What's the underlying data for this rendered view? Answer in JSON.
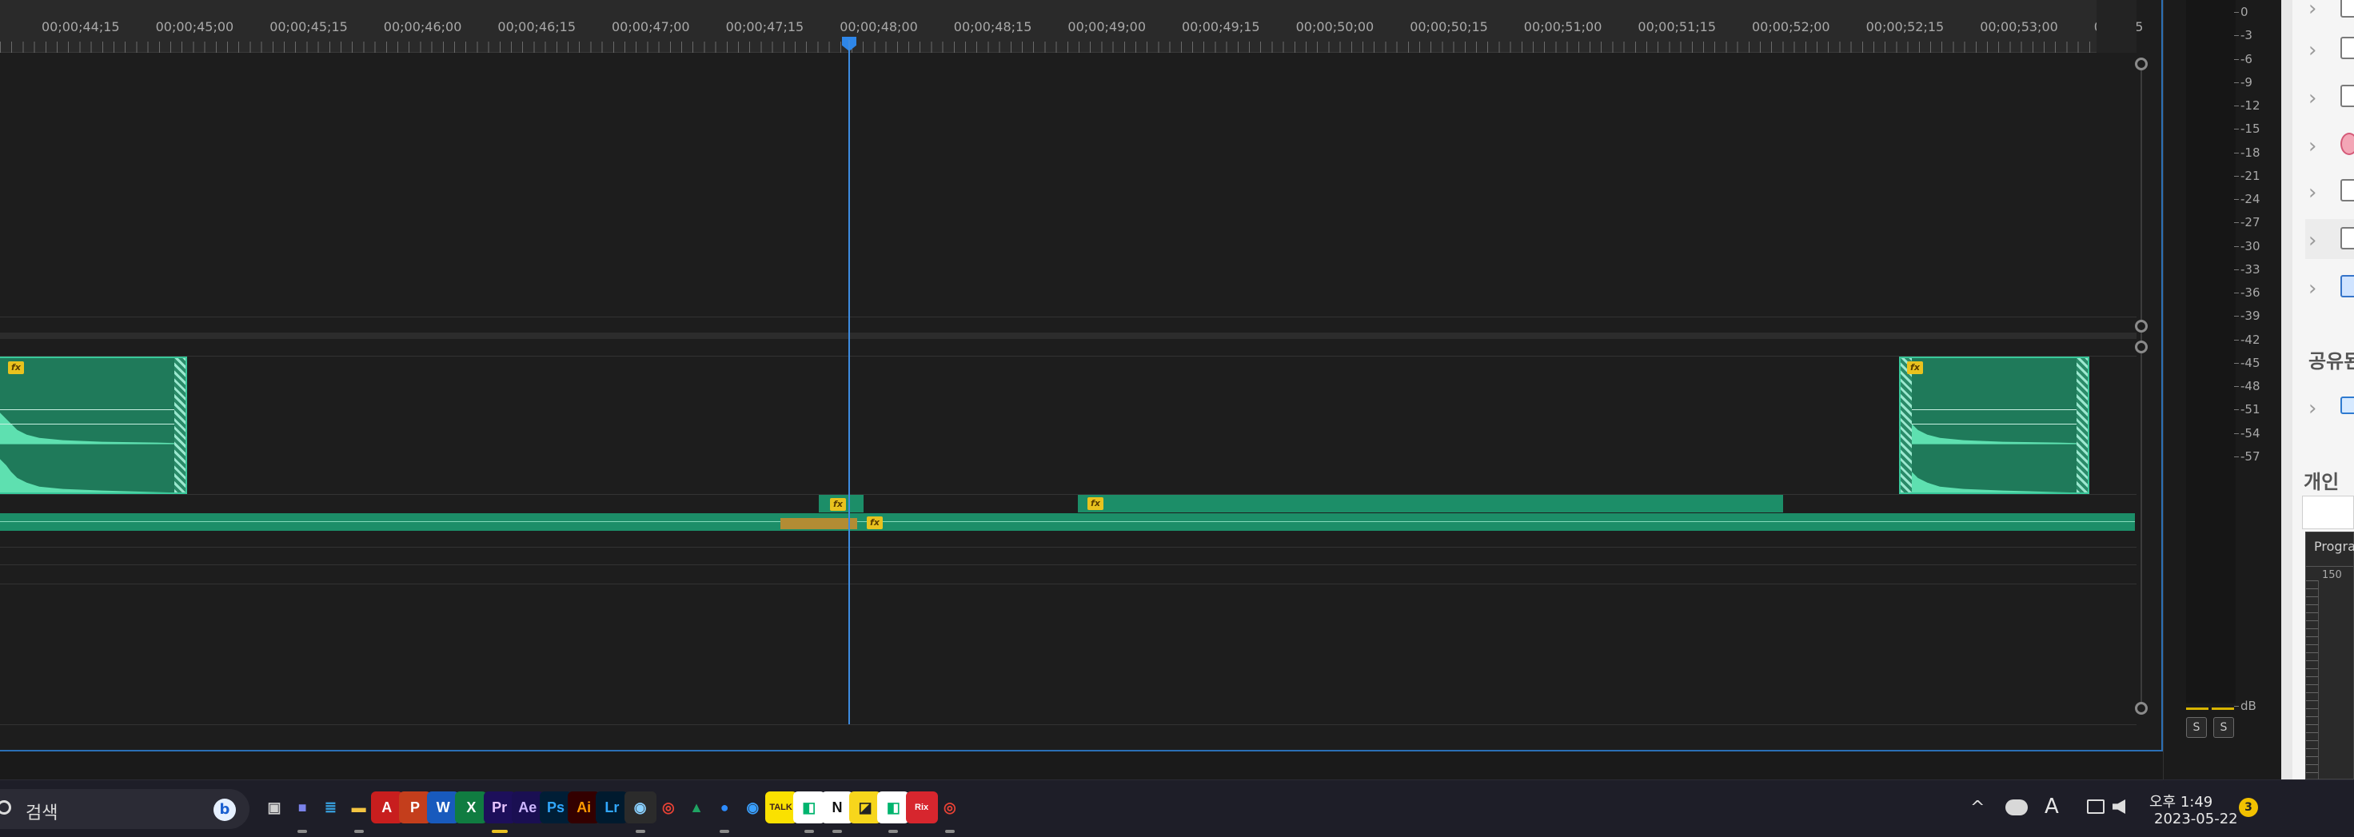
{
  "timeline": {
    "ruler_labels": [
      "00;00;44;15",
      "00;00;45;00",
      "00;00;45;15",
      "00;00;46;00",
      "00;00;46;15",
      "00;00;47;00",
      "00;00;47;15",
      "00;00;48;00",
      "00;00;48;15",
      "00;00;49;00",
      "00;00;49;15",
      "00;00;50;00",
      "00;00;50;15",
      "00;00;51;00",
      "00;00;51;15",
      "00;00;52;00",
      "00;00;52;15",
      "00;00;53;00",
      "00;00;5"
    ],
    "fx_label": "fx",
    "playhead_time": "00;00;48;00"
  },
  "audio_meter": {
    "db_labels": [
      "0",
      "-3",
      "-6",
      "-9",
      "-12",
      "-15",
      "-18",
      "-21",
      "-24",
      "-27",
      "-30",
      "-33",
      "-36",
      "-39",
      "-42",
      "-45",
      "-48",
      "-51",
      "-54",
      "-57",
      "dB"
    ],
    "solo_left": "S",
    "solo_right": "S",
    "level_color": "#d8b400"
  },
  "side_panel": {
    "section_shared": "공유된",
    "section_personal": "개인",
    "program_label": "Progra",
    "ruler_150": "150"
  },
  "taskbar": {
    "search_placeholder": "검색",
    "bing_label": "b",
    "apps": [
      {
        "name": "task-view",
        "glyph": "▣",
        "color": "#d0d0d0",
        "bg": "transparent"
      },
      {
        "name": "teams",
        "glyph": "■",
        "color": "#7b83eb",
        "bg": "transparent"
      },
      {
        "name": "notepad",
        "glyph": "≣",
        "color": "#38a1e0",
        "bg": "transparent"
      },
      {
        "name": "file-explorer",
        "glyph": "▬",
        "color": "#f4c542",
        "bg": "transparent"
      },
      {
        "name": "acrobat",
        "glyph": "A",
        "color": "#ffffff",
        "bg": "#c81e1e"
      },
      {
        "name": "powerpoint",
        "glyph": "P",
        "color": "#ffffff",
        "bg": "#c43e1c"
      },
      {
        "name": "word",
        "glyph": "W",
        "color": "#ffffff",
        "bg": "#185abd"
      },
      {
        "name": "excel",
        "glyph": "X",
        "color": "#ffffff",
        "bg": "#107c41"
      },
      {
        "name": "premiere-pro",
        "glyph": "Pr",
        "color": "#e7c3ff",
        "bg": "#1d0f5a"
      },
      {
        "name": "after-effects",
        "glyph": "Ae",
        "color": "#cdb7ff",
        "bg": "#1a0f52"
      },
      {
        "name": "photoshop",
        "glyph": "Ps",
        "color": "#31a8ff",
        "bg": "#001e36"
      },
      {
        "name": "illustrator",
        "glyph": "Ai",
        "color": "#ff9a00",
        "bg": "#330000"
      },
      {
        "name": "lightroom",
        "glyph": "Lr",
        "color": "#31a8ff",
        "bg": "#001a2e"
      },
      {
        "name": "davinci-resolve",
        "glyph": "◉",
        "color": "#8ad0ff",
        "bg": "#2b2b2b"
      },
      {
        "name": "chrome",
        "glyph": "◎",
        "color": "#e94235",
        "bg": "transparent"
      },
      {
        "name": "google-drive",
        "glyph": "▲",
        "color": "#1fa463",
        "bg": "transparent"
      },
      {
        "name": "zoom",
        "glyph": "●",
        "color": "#2d8cff",
        "bg": "transparent"
      },
      {
        "name": "messenger",
        "glyph": "◉",
        "color": "#3aa0ff",
        "bg": "transparent"
      },
      {
        "name": "kakaotalk",
        "glyph": "TALK",
        "color": "#3a1d1d",
        "bg": "#fae100"
      },
      {
        "name": "line-works",
        "glyph": "◧",
        "color": "#00b46e",
        "bg": "#ffffff"
      },
      {
        "name": "notion",
        "glyph": "N",
        "color": "#111111",
        "bg": "#ffffff"
      },
      {
        "name": "sticky-notes",
        "glyph": "◪",
        "color": "#222222",
        "bg": "#f7d61c"
      },
      {
        "name": "line-works-2",
        "glyph": "◧",
        "color": "#00b46e",
        "bg": "#ffffff"
      },
      {
        "name": "rix",
        "glyph": "Rix",
        "color": "#ffffff",
        "bg": "#d7262e"
      },
      {
        "name": "chrome-2",
        "glyph": "◎",
        "color": "#e94235",
        "bg": "transparent"
      }
    ],
    "clock": {
      "time": "오후 1:49",
      "date": "2023-05-22"
    },
    "notification_count": "3",
    "tray_chevron": "^",
    "ime_label": "A"
  }
}
